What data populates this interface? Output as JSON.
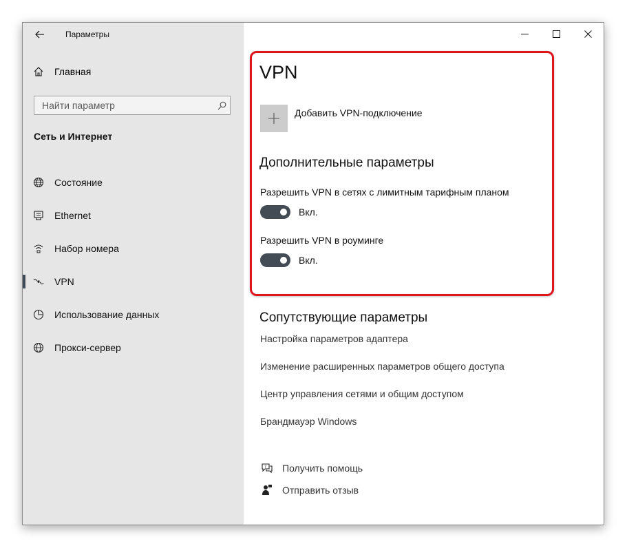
{
  "window": {
    "app_title": "Параметры"
  },
  "sidebar": {
    "home_label": "Главная",
    "search_placeholder": "Найти параметр",
    "section_header": "Сеть и Интернет",
    "items": [
      {
        "label": "Состояние",
        "icon": "globe-icon"
      },
      {
        "label": "Ethernet",
        "icon": "ethernet-icon"
      },
      {
        "label": "Набор номера",
        "icon": "dialup-icon"
      },
      {
        "label": "VPN",
        "icon": "vpn-icon",
        "active": true
      },
      {
        "label": "Использование данных",
        "icon": "data-usage-icon"
      },
      {
        "label": "Прокси-сервер",
        "icon": "proxy-globe-icon"
      }
    ]
  },
  "main": {
    "title": "VPN",
    "add_vpn_label": "Добавить VPN-подключение",
    "advanced_title": "Дополнительные параметры",
    "settings": [
      {
        "label": "Разрешить VPN в сетях с лимитным тарифным планом",
        "state": "Вкл.",
        "on": true
      },
      {
        "label": "Разрешить VPN в роуминге",
        "state": "Вкл.",
        "on": true
      }
    ],
    "related_title": "Сопутствующие параметры",
    "related_links": [
      "Настройка параметров адаптера",
      "Изменение расширенных параметров общего доступа",
      "Центр управления сетями и общим доступом",
      "Брандмауэр Windows"
    ],
    "help": {
      "get_help": "Получить помощь",
      "feedback": "Отправить отзыв"
    }
  },
  "colors": {
    "sidebar_bg": "#e6e6e6",
    "toggle_on": "#434b55",
    "highlight": "#e0151b"
  }
}
